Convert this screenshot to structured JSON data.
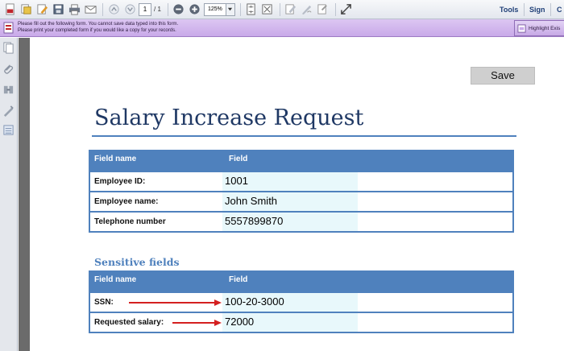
{
  "toolbar": {
    "page_current": "1",
    "page_total": "/ 1",
    "zoom": "125%",
    "tools_label": "Tools",
    "sign_label": "Sign",
    "comment_label": "C"
  },
  "notice": {
    "line1": "Please fill out the following form. You cannot save data typed into this form.",
    "line2": "Please print your completed form if you would like a copy for your records.",
    "highlight_label": "Highlight Exis"
  },
  "document": {
    "save_label": "Save",
    "title": "Salary Increase Request",
    "table1": {
      "col1": "Field name",
      "col2": "Field",
      "rows": [
        {
          "label": "Employee ID:",
          "value": "1001"
        },
        {
          "label": "Employee name:",
          "value": "John Smith"
        },
        {
          "label": "Telephone number",
          "value": "5557899870"
        }
      ]
    },
    "section_title": "Sensitive fields",
    "table2": {
      "col1": "Field name",
      "col2": "Field",
      "rows": [
        {
          "label": "SSN:",
          "value": "100-20-3000"
        },
        {
          "label": "Requested salary:",
          "value": "72000"
        }
      ]
    }
  },
  "colors": {
    "accent": "#4f81bd",
    "title": "#1f3864",
    "field_bg": "#e8f8fb",
    "notice_bg": "#c9aae9",
    "arrow": "#d42020"
  },
  "icons": [
    "create-pdf-icon",
    "open-icon",
    "edit-icon",
    "save-icon",
    "print-icon",
    "email-icon",
    "prev-page-icon",
    "next-page-icon",
    "zoom-out-icon",
    "zoom-in-icon",
    "fit-page-icon",
    "full-screen-icon",
    "comment-icon",
    "sign-icon",
    "share-icon",
    "expand-icon",
    "pages-icon",
    "attachment-icon",
    "signatures-icon",
    "security-icon",
    "layers-icon"
  ]
}
